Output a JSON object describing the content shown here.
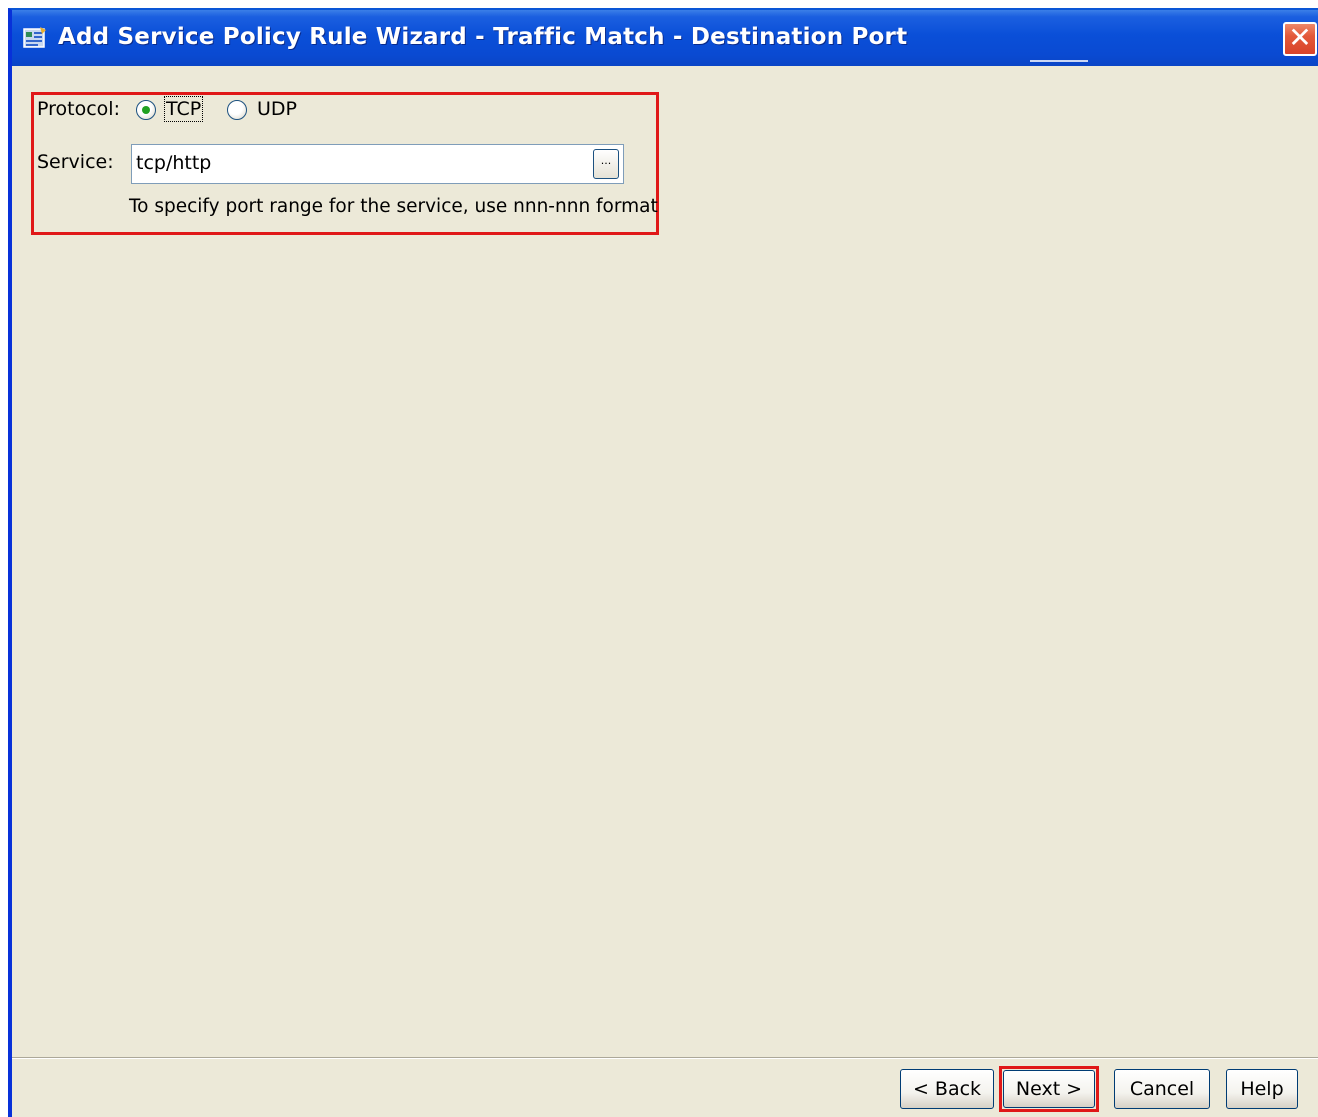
{
  "window": {
    "title": "Add Service Policy Rule Wizard - Traffic Match - Destination Port",
    "close_glyph": "✕",
    "icon": "wizard-app-icon",
    "colors": {
      "titlebar": "#0A4FD8",
      "body": "#ECE9D8",
      "highlight": "#E01818",
      "close": "#D8432A"
    }
  },
  "form": {
    "protocol_label": "Protocol:",
    "protocol_options": [
      {
        "label": "TCP",
        "selected": true
      },
      {
        "label": "UDP",
        "selected": false
      }
    ],
    "service_label": "Service:",
    "service_value": "tcp/http",
    "browse_label": "...",
    "hint": "To specify port range for the service, use nnn-nnn format"
  },
  "footer": {
    "back_label": "< Back",
    "next_label": "Next >",
    "cancel_label": "Cancel",
    "help_label": "Help"
  }
}
